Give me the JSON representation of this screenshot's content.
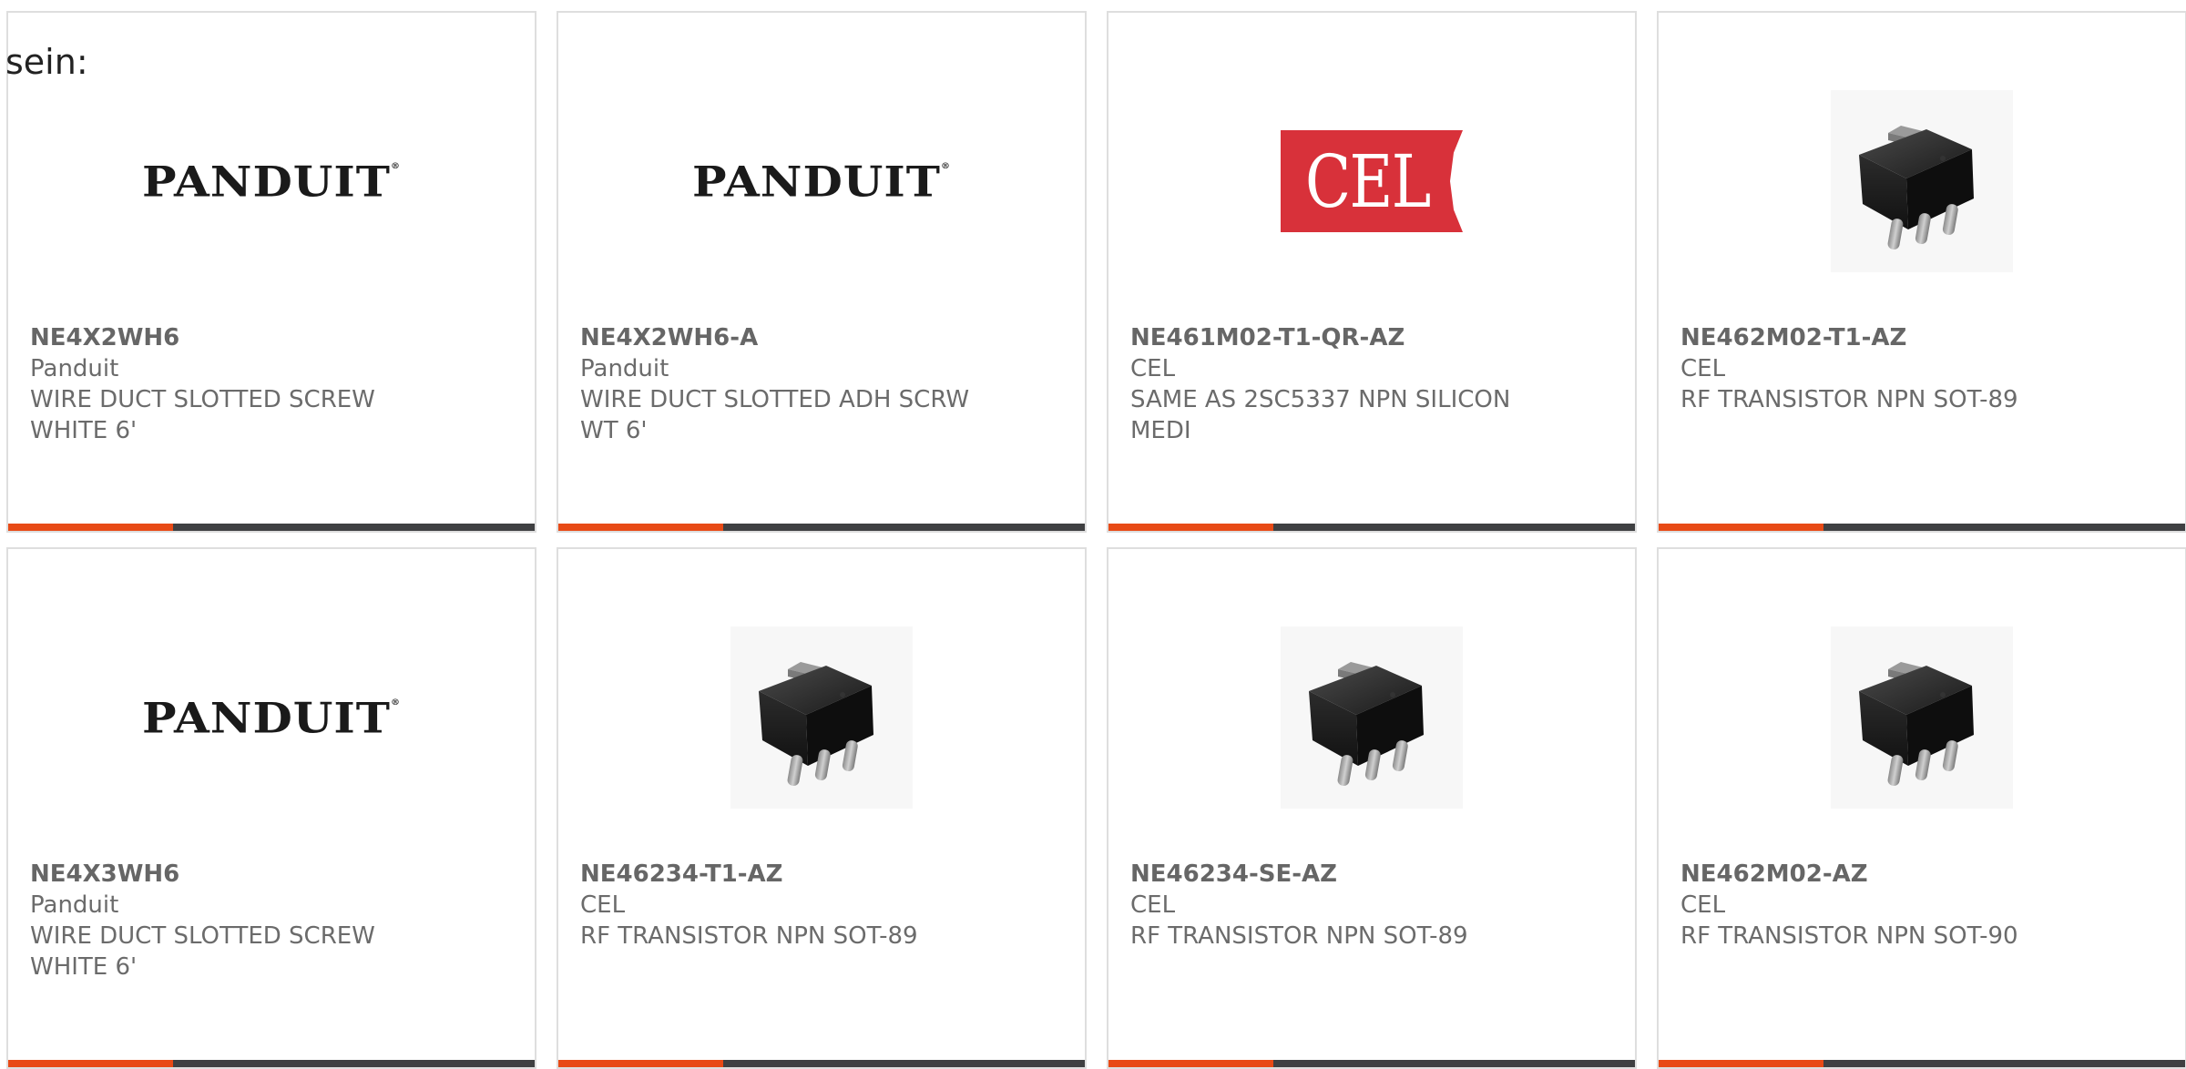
{
  "intro_text": "sein:",
  "colors": {
    "accent": "#e84a16",
    "bar": "#3f4042",
    "border": "#dedede",
    "text": "#6b6b6b",
    "cel_red": "#d8313a"
  },
  "products": [
    {
      "part_number": "NE4X2WH6",
      "manufacturer": "Panduit",
      "description": "WIRE DUCT SLOTTED SCREW WHITE 6'",
      "image": "panduit-logo",
      "logo_text": "PANDUIT"
    },
    {
      "part_number": "NE4X2WH6-A",
      "manufacturer": "Panduit",
      "description": "WIRE DUCT SLOTTED ADH SCRW WT 6'",
      "image": "panduit-logo",
      "logo_text": "PANDUIT"
    },
    {
      "part_number": "NE461M02-T1-QR-AZ",
      "manufacturer": "CEL",
      "description": "SAME AS 2SC5337 NPN SILICON MEDI",
      "image": "cel-logo",
      "logo_text": "CEL"
    },
    {
      "part_number": "NE462M02-T1-AZ",
      "manufacturer": "CEL",
      "description": "RF TRANSISTOR NPN SOT-89",
      "image": "transistor-photo"
    },
    {
      "part_number": "NE4X3WH6",
      "manufacturer": "Panduit",
      "description": "WIRE DUCT SLOTTED SCREW WHITE 6'",
      "image": "panduit-logo",
      "logo_text": "PANDUIT"
    },
    {
      "part_number": "NE46234-T1-AZ",
      "manufacturer": "CEL",
      "description": "RF TRANSISTOR NPN SOT-89",
      "image": "transistor-photo"
    },
    {
      "part_number": "NE46234-SE-AZ",
      "manufacturer": "CEL",
      "description": "RF TRANSISTOR NPN SOT-89",
      "image": "transistor-photo"
    },
    {
      "part_number": "NE462M02-AZ",
      "manufacturer": "CEL",
      "description": "RF TRANSISTOR NPN SOT-90",
      "image": "transistor-photo"
    }
  ]
}
